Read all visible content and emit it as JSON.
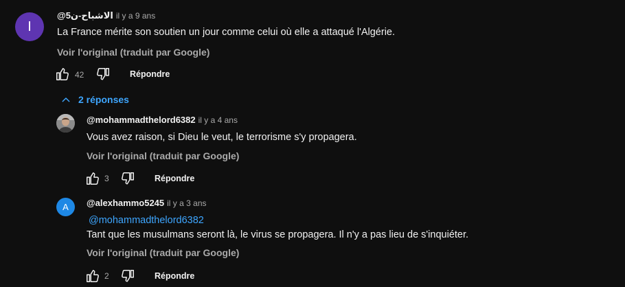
{
  "comment": {
    "avatar_letter": "I",
    "avatar_color": "#5e35b1",
    "author": "@الاشباح-ن5",
    "time": "il y a 9 ans",
    "text": "La France mérite son soutien un jour comme celui où elle a attaqué l'Algérie.",
    "translate_label": "Voir l'original (traduit par Google)",
    "likes": "42",
    "reply_label": "Répondre"
  },
  "replies_toggle": {
    "label": "2 réponses",
    "icon": "chevron-up-icon"
  },
  "replies": [
    {
      "avatar_type": "photo",
      "author": "@mohammadthelord6382",
      "time": "il y a 4 ans",
      "text": "Vous avez raison, si Dieu le veut, le terrorisme s'y propagera.",
      "translate_label": "Voir l'original (traduit par Google)",
      "likes": "3",
      "reply_label": "Répondre"
    },
    {
      "avatar_letter": "A",
      "avatar_color": "#1e88e5",
      "author": "@alexhammo5245",
      "time": "il y a 3 ans",
      "mention": "@mohammadthelord6382",
      "text": "Tant que les musulmans seront là, le virus se propagera. Il n'y a pas lieu de s'inquiéter.",
      "translate_label": "Voir l'original (traduit par Google)",
      "likes": "2",
      "reply_label": "Répondre"
    }
  ]
}
